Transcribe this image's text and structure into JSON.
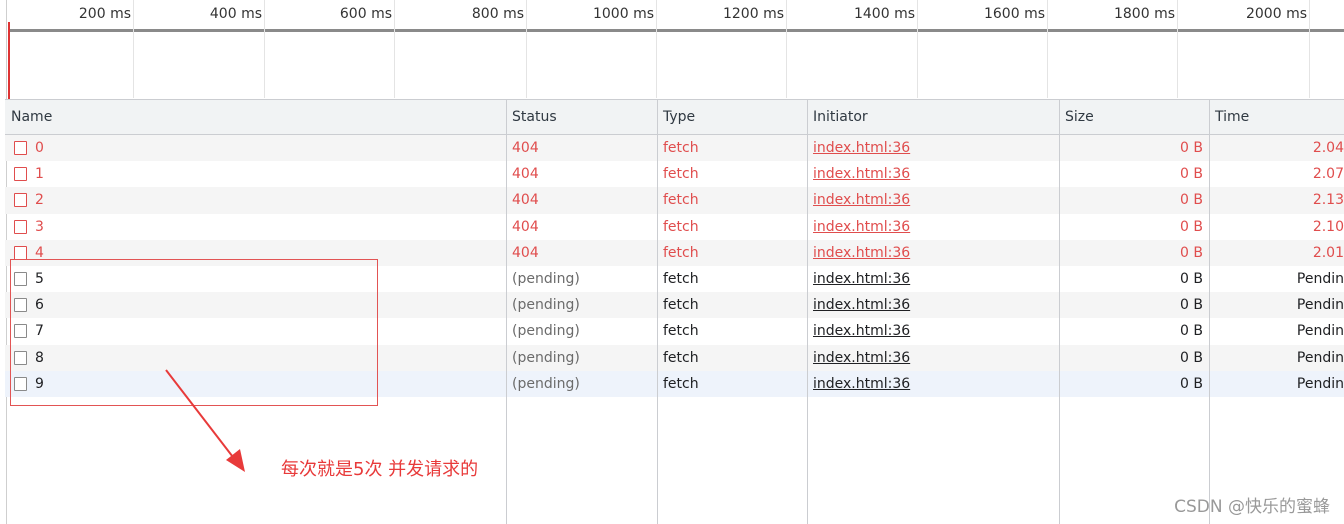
{
  "overview": {
    "ticks": [
      "200 ms",
      "400 ms",
      "600 ms",
      "800 ms",
      "1000 ms",
      "1200 ms",
      "1400 ms",
      "1600 ms",
      "1800 ms",
      "2000 ms"
    ]
  },
  "table": {
    "columns": [
      "Name",
      "Status",
      "Type",
      "Initiator",
      "Size",
      "Time"
    ],
    "rows": [
      {
        "name": "0",
        "status": "404",
        "type": "fetch",
        "initiator": "index.html:36",
        "size": "0 B",
        "time": "2.04",
        "error": true
      },
      {
        "name": "1",
        "status": "404",
        "type": "fetch",
        "initiator": "index.html:36",
        "size": "0 B",
        "time": "2.07",
        "error": true
      },
      {
        "name": "2",
        "status": "404",
        "type": "fetch",
        "initiator": "index.html:36",
        "size": "0 B",
        "time": "2.13",
        "error": true
      },
      {
        "name": "3",
        "status": "404",
        "type": "fetch",
        "initiator": "index.html:36",
        "size": "0 B",
        "time": "2.10",
        "error": true
      },
      {
        "name": "4",
        "status": "404",
        "type": "fetch",
        "initiator": "index.html:36",
        "size": "0 B",
        "time": "2.01",
        "error": true
      },
      {
        "name": "5",
        "status": "(pending)",
        "type": "fetch",
        "initiator": "index.html:36",
        "size": "0 B",
        "time": "Pendin",
        "error": false
      },
      {
        "name": "6",
        "status": "(pending)",
        "type": "fetch",
        "initiator": "index.html:36",
        "size": "0 B",
        "time": "Pendin",
        "error": false
      },
      {
        "name": "7",
        "status": "(pending)",
        "type": "fetch",
        "initiator": "index.html:36",
        "size": "0 B",
        "time": "Pendin",
        "error": false
      },
      {
        "name": "8",
        "status": "(pending)",
        "type": "fetch",
        "initiator": "index.html:36",
        "size": "0 B",
        "time": "Pendin",
        "error": false
      },
      {
        "name": "9",
        "status": "(pending)",
        "type": "fetch",
        "initiator": "index.html:36",
        "size": "0 B",
        "time": "Pendin",
        "error": false
      }
    ]
  },
  "annotation": {
    "text": "每次就是5次 并发请求的",
    "color": "#e83a3a"
  },
  "watermark": "CSDN @快乐的蜜蜂",
  "colors": {
    "error": "#e04d4d",
    "header_bg": "#f1f3f4",
    "row_alt": "#f5f5f5"
  }
}
